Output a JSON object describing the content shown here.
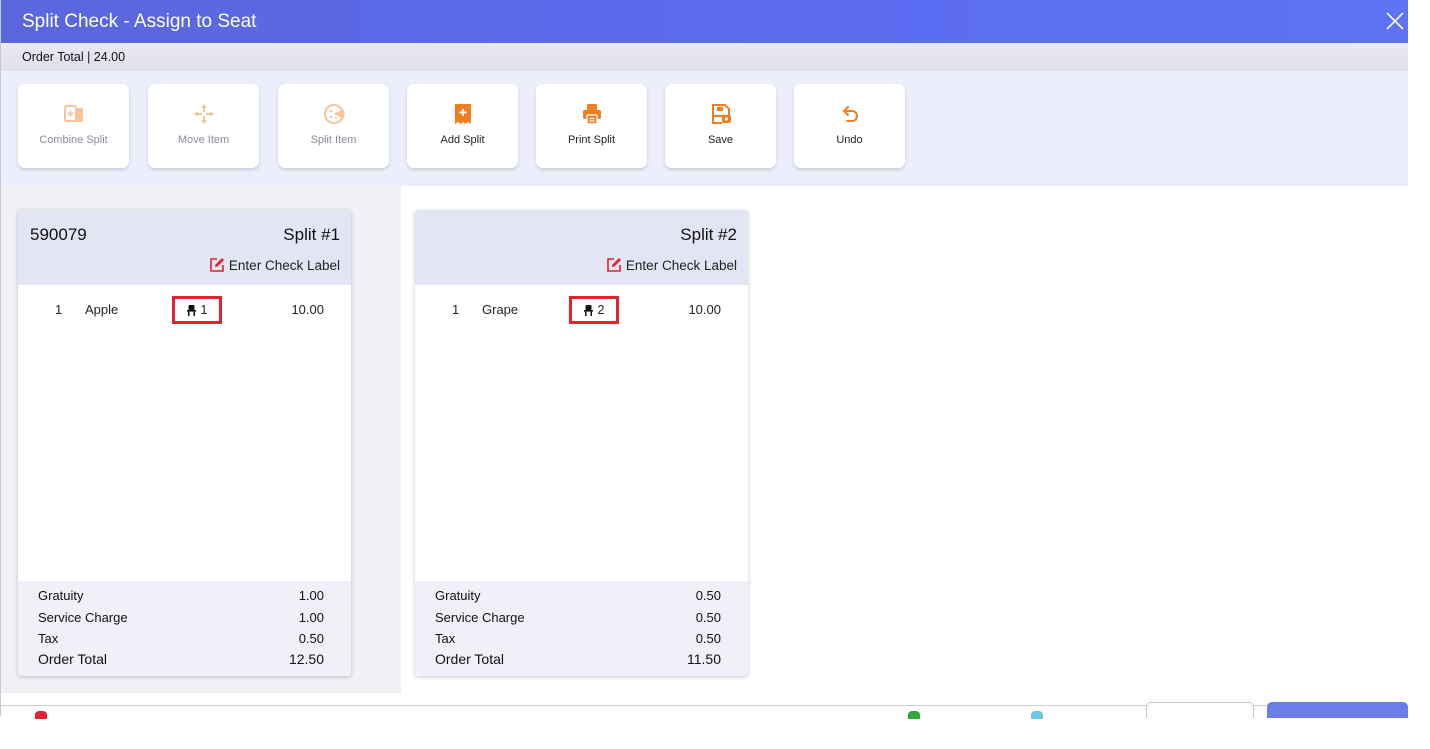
{
  "window": {
    "title": "Split Check - Assign to Seat",
    "close_icon": "close-icon"
  },
  "order_total_bar": {
    "text": "Order Total | 24.00"
  },
  "toolbar": {
    "buttons": [
      {
        "label": "Combine Split",
        "icon": "combine-icon",
        "enabled": false
      },
      {
        "label": "Move Item",
        "icon": "move-arrows-icon",
        "enabled": false
      },
      {
        "label": "Split Item",
        "icon": "pizza-slice-icon",
        "enabled": false
      },
      {
        "label": "Add Split",
        "icon": "add-receipt-icon",
        "enabled": true
      },
      {
        "label": "Print Split",
        "icon": "printer-icon",
        "enabled": true
      },
      {
        "label": "Save",
        "icon": "save-icon",
        "enabled": true
      },
      {
        "label": "Undo",
        "icon": "undo-icon",
        "enabled": true
      }
    ]
  },
  "accent_color": "#f07d1f",
  "seat_highlight_color": "#e0232e",
  "splits": [
    {
      "order_number": "590079",
      "split_label": "Split #1",
      "check_label_link": "Enter Check Label",
      "items": [
        {
          "qty": "1",
          "name": "Apple",
          "seat": "1",
          "price": "10.00"
        }
      ],
      "footer": {
        "gratuity_label": "Gratuity",
        "gratuity": "1.00",
        "service_label": "Service Charge",
        "service": "1.00",
        "tax_label": "Tax",
        "tax": "0.50",
        "total_label": "Order Total",
        "total": "12.50"
      }
    },
    {
      "order_number": "",
      "split_label": "Split #2",
      "check_label_link": "Enter Check Label",
      "items": [
        {
          "qty": "1",
          "name": "Grape",
          "seat": "2",
          "price": "10.00"
        }
      ],
      "footer": {
        "gratuity_label": "Gratuity",
        "gratuity": "0.50",
        "service_label": "Service Charge",
        "service": "0.50",
        "tax_label": "Tax",
        "tax": "0.50",
        "total_label": "Order Total",
        "total": "11.50"
      }
    }
  ]
}
